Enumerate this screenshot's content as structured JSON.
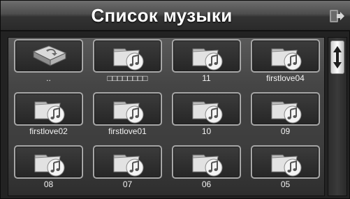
{
  "header": {
    "title": "Список музыки",
    "exit_icon": "exit-icon"
  },
  "scrollbar": {
    "thumb_icon": "up-down-arrows-icon"
  },
  "items": [
    {
      "label": "..",
      "icon": "parent-folder-icon"
    },
    {
      "label": "□□□□□□□□",
      "icon": "music-folder-icon"
    },
    {
      "label": "11",
      "icon": "music-folder-icon"
    },
    {
      "label": "firstlove04",
      "icon": "music-folder-icon"
    },
    {
      "label": "firstlove02",
      "icon": "music-folder-icon"
    },
    {
      "label": "firstlove01",
      "icon": "music-folder-icon"
    },
    {
      "label": "10",
      "icon": "music-folder-icon"
    },
    {
      "label": "09",
      "icon": "music-folder-icon"
    },
    {
      "label": "08",
      "icon": "music-folder-icon"
    },
    {
      "label": "07",
      "icon": "music-folder-icon"
    },
    {
      "label": "06",
      "icon": "music-folder-icon"
    },
    {
      "label": "05",
      "icon": "music-folder-icon"
    }
  ]
}
